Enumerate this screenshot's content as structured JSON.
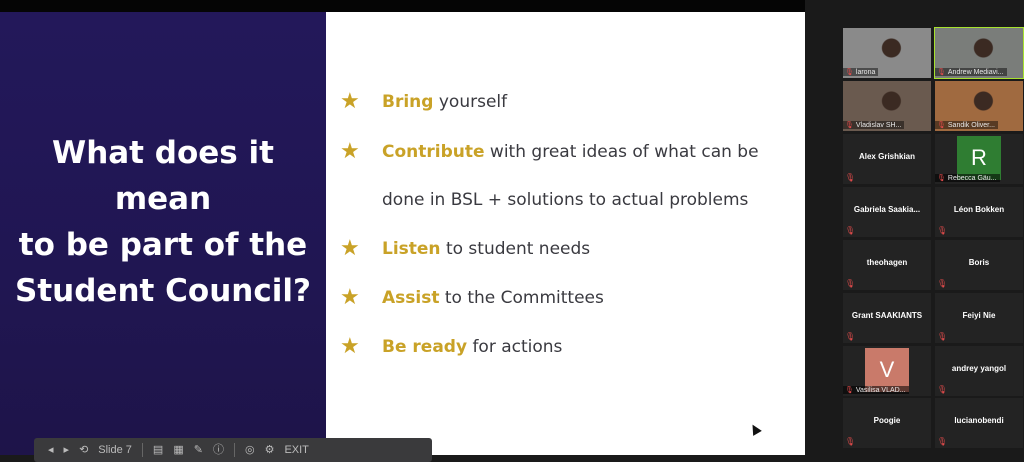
{
  "slide": {
    "title_lines": [
      "What does it",
      "mean",
      "to be part of the",
      "Student Council?"
    ],
    "bullets": [
      {
        "keyword": "Bring",
        "rest": " yourself",
        "continuation": ""
      },
      {
        "keyword": "Contribute",
        "rest": " with great ideas of what can be",
        "continuation": "done in BSL + solutions to actual problems"
      },
      {
        "keyword": "Listen",
        "rest": " to student needs",
        "continuation": ""
      },
      {
        "keyword": "Assist",
        "rest": " to the Committees",
        "continuation": ""
      },
      {
        "keyword": "Be ready",
        "rest": " for actions",
        "continuation": ""
      }
    ],
    "bullet_icon": "star-icon",
    "colors": {
      "title_panel": "#23185a",
      "accent": "#c9a227",
      "text": "#3a3a40",
      "active_speaker": "#a6e22e",
      "muted_mic": "#e24b4b"
    }
  },
  "toolbar": {
    "items": [
      "◂",
      "▸",
      "⟲",
      "Slide 7",
      "▤",
      "▦",
      "✎",
      "ⓘ",
      "◎",
      "⚙",
      "EXIT"
    ]
  },
  "participants": [
    {
      "name": "larona",
      "video": true,
      "bg": "#8a8a8a"
    },
    {
      "name": "Andrew Mediavi...",
      "video": true,
      "bg": "#7a7d7a",
      "active": true
    },
    {
      "name": "Vladislav SH...",
      "video": true,
      "bg": "#6a5a4f"
    },
    {
      "name": "Sandik Oliver...",
      "video": true,
      "bg": "#a06a40"
    },
    {
      "name": "Alex Grishkian",
      "video": false
    },
    {
      "name": "Rebecca Gäu...",
      "video": false,
      "avatar": "R",
      "avatar_color": "#2f7d32"
    },
    {
      "name": "Gabriela  Saakia...",
      "video": false
    },
    {
      "name": "Léon Bokken",
      "video": false
    },
    {
      "name": "theohagen",
      "video": false
    },
    {
      "name": "Boris",
      "video": false
    },
    {
      "name": "Grant SAAKIANTS",
      "video": false
    },
    {
      "name": "Feiyi Nie",
      "video": false
    },
    {
      "name": "Vasilisa VLAD...",
      "video": false,
      "avatar": "V",
      "avatar_color": "#c97a6a"
    },
    {
      "name": "andrey yangol",
      "video": false
    },
    {
      "name": "Poogie",
      "video": false
    },
    {
      "name": "lucianobendi",
      "video": false
    }
  ]
}
